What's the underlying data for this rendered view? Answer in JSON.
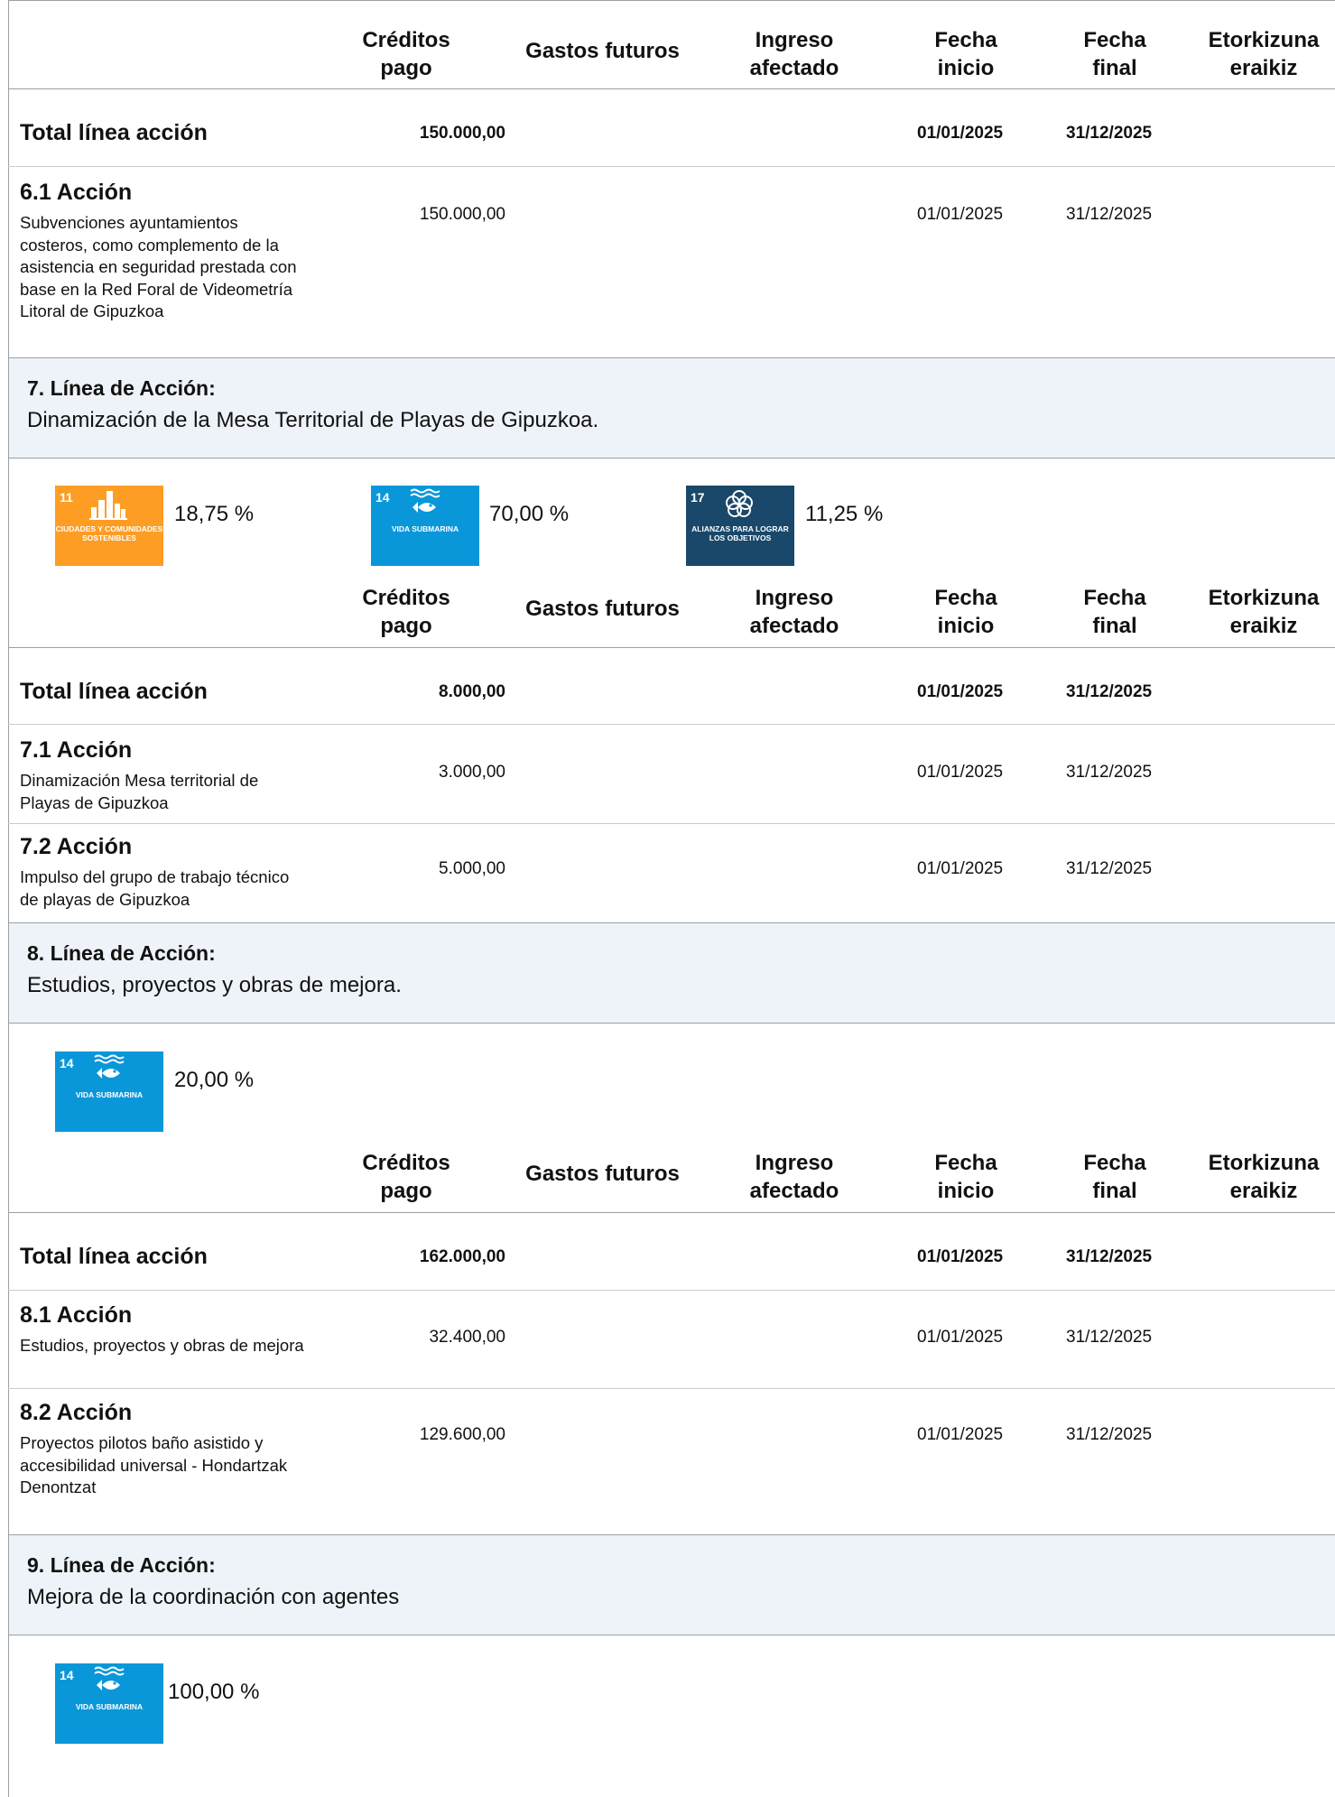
{
  "headers": {
    "creditos": [
      "Créditos",
      "pago"
    ],
    "gastos": "Gastos futuros",
    "ingreso": [
      "Ingreso",
      "afectado"
    ],
    "fecha_inicio": [
      "Fecha",
      "inicio"
    ],
    "fecha_final": [
      "Fecha",
      "final"
    ],
    "etorkizuna": [
      "Etorkizuna",
      "eraikiz"
    ]
  },
  "total_label": "Total línea acción",
  "section6": {
    "total": {
      "creditos": "150.000,00",
      "inicio": "01/01/2025",
      "final": "31/12/2025"
    },
    "actions": [
      {
        "title": "6.1 Acción",
        "desc": "Subvenciones ayuntamientos costeros, como complemento de la asistencia en seguridad prestada con base en la Red Foral de Videometría Litoral de Gipuzkoa",
        "creditos": "150.000,00",
        "inicio": "01/01/2025",
        "final": "31/12/2025"
      }
    ]
  },
  "section7": {
    "title": "7. Línea de Acción:",
    "desc": "Dinamización de la Mesa Territorial de Playas de Gipuzkoa.",
    "ods": [
      {
        "num": "11",
        "label": "CIUDADES Y COMUNIDADES SOSTENIBLES",
        "icon": "city-buildings-icon",
        "color": "#fd9d24",
        "pct": "18,75 %"
      },
      {
        "num": "14",
        "label": "VIDA SUBMARINA",
        "icon": "fish-waves-icon",
        "color": "#0a97d9",
        "pct": "70,00 %"
      },
      {
        "num": "17",
        "label": "ALIANZAS PARA LOGRAR LOS OBJETIVOS",
        "icon": "partnership-flower-icon",
        "color": "#19486a",
        "pct": "11,25 %"
      }
    ],
    "total": {
      "creditos": "8.000,00",
      "inicio": "01/01/2025",
      "final": "31/12/2025"
    },
    "actions": [
      {
        "title": "7.1 Acción",
        "desc": "Dinamización Mesa territorial de Playas de Gipuzkoa",
        "creditos": "3.000,00",
        "inicio": "01/01/2025",
        "final": "31/12/2025"
      },
      {
        "title": "7.2 Acción",
        "desc": "Impulso del grupo de trabajo técnico de playas de Gipuzkoa",
        "creditos": "5.000,00",
        "inicio": "01/01/2025",
        "final": "31/12/2025"
      }
    ]
  },
  "section8": {
    "title": "8. Línea de Acción:",
    "desc": "Estudios, proyectos y obras de mejora.",
    "ods": [
      {
        "num": "14",
        "label": "VIDA SUBMARINA",
        "icon": "fish-waves-icon",
        "color": "#0a97d9",
        "pct": "20,00 %"
      }
    ],
    "total": {
      "creditos": "162.000,00",
      "inicio": "01/01/2025",
      "final": "31/12/2025"
    },
    "actions": [
      {
        "title": "8.1 Acción",
        "desc": "Estudios, proyectos y obras de mejora",
        "creditos": "32.400,00",
        "inicio": "01/01/2025",
        "final": "31/12/2025"
      },
      {
        "title": "8.2 Acción",
        "desc": "Proyectos pilotos baño asistido y accesibilidad universal - Hondartzak Denontzat",
        "creditos": "129.600,00",
        "inicio": "01/01/2025",
        "final": "31/12/2025"
      }
    ]
  },
  "section9": {
    "title": "9. Línea de Acción:",
    "desc": "Mejora de la coordinación con agentes",
    "ods": [
      {
        "num": "14",
        "label": "VIDA SUBMARINA",
        "icon": "fish-waves-icon",
        "color": "#0a97d9",
        "pct": "100,00 %"
      }
    ]
  }
}
